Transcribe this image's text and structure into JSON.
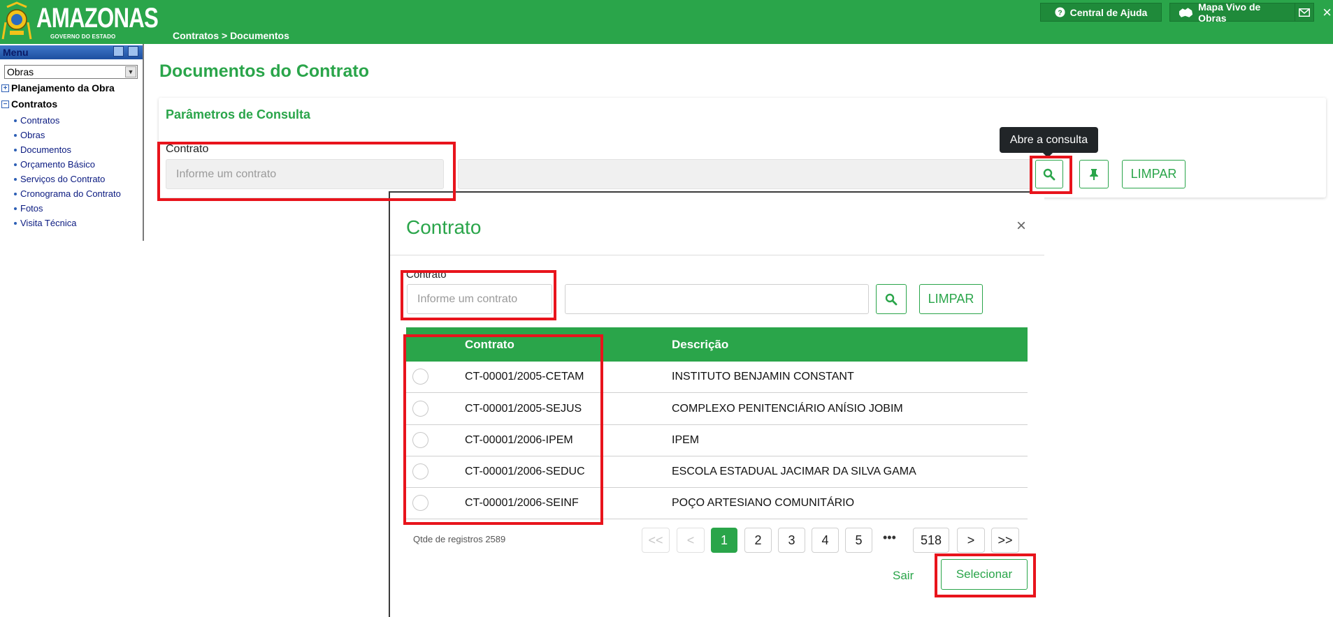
{
  "header": {
    "logo_text": "AMAZONAS",
    "logo_sub": "GOVERNO DO ESTADO",
    "breadcrumb": "Contratos > Documentos",
    "help_label": "Central de Ajuda",
    "map_label": "Mapa Vivo de Obras",
    "close_glyph": "×",
    "colors": {
      "bar": "#2aa54a",
      "button": "#1f8a3a"
    }
  },
  "sidebar": {
    "title": "Menu",
    "module_select": "Obras",
    "nodes": [
      {
        "toggle": "+",
        "label": "Planejamento da Obra"
      },
      {
        "toggle": "−",
        "label": "Contratos"
      }
    ],
    "items": [
      {
        "label": "Contratos"
      },
      {
        "label": "Obras"
      },
      {
        "label": "Documentos"
      },
      {
        "label": "Orçamento Básico"
      },
      {
        "label": "Serviços do Contrato"
      },
      {
        "label": "Cronograma do Contrato"
      },
      {
        "label": "Fotos"
      },
      {
        "label": "Visita Técnica"
      }
    ]
  },
  "main": {
    "title": "Documentos do Contrato",
    "params_title": "Parâmetros de Consulta",
    "contract_label": "Contrato",
    "contract_placeholder": "Informe um contrato",
    "tooltip": "Abre a consulta",
    "clear_label": "LIMPAR",
    "icons": {
      "search": "search-icon",
      "pin": "pin-icon"
    }
  },
  "modal": {
    "title": "Contrato",
    "close_glyph": "×",
    "contract_label": "Contrato",
    "contract_placeholder": "Informe um contrato",
    "clear_label": "LIMPAR",
    "columns": [
      "Contrato",
      "Descrição"
    ],
    "rows": [
      {
        "contrato": "CT-00001/2005-CETAM",
        "descricao": "INSTITUTO BENJAMIN CONSTANT"
      },
      {
        "contrato": "CT-00001/2005-SEJUS",
        "descricao": "COMPLEXO PENITENCIÁRIO ANÍSIO JOBIM"
      },
      {
        "contrato": "CT-00001/2006-IPEM",
        "descricao": "IPEM"
      },
      {
        "contrato": "CT-00001/2006-SEDUC",
        "descricao": "ESCOLA ESTADUAL JACIMAR DA SILVA GAMA"
      },
      {
        "contrato": "CT-00001/2006-SEINF",
        "descricao": "POÇO ARTESIANO COMUNITÁRIO"
      }
    ],
    "record_count": "Qtde de registros 2589",
    "pagination": {
      "first": "<<",
      "prev": "<",
      "pages": [
        "1",
        "2",
        "3",
        "4",
        "5"
      ],
      "ellipsis": "•••",
      "last_page": "518",
      "next": ">",
      "last": ">>",
      "current": "1"
    },
    "exit_label": "Sair",
    "select_label": "Selecionar"
  },
  "annotation_color": "#e8141c"
}
